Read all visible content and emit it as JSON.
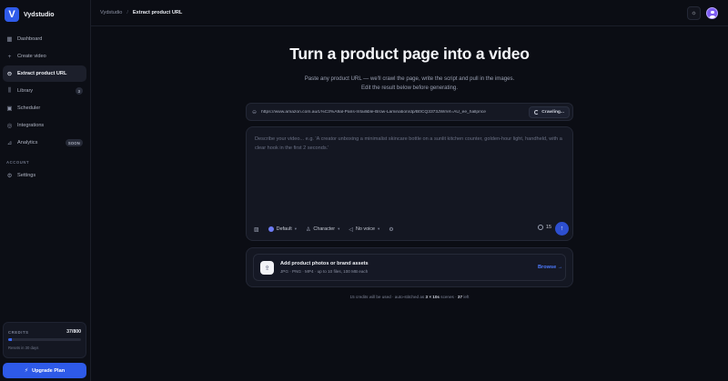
{
  "app": {
    "logo_letter": "V",
    "name": "Vydstudio"
  },
  "sidebar": {
    "items": [
      {
        "label": "Dashboard",
        "icon": "dashboard-icon",
        "active": false
      },
      {
        "label": "Create video",
        "icon": "plus-icon",
        "active": false
      },
      {
        "label": "Extract product URL",
        "icon": "link-icon",
        "active": true
      },
      {
        "label": "Library",
        "icon": "library-icon",
        "badge": "3",
        "active": false
      },
      {
        "label": "Scheduler",
        "icon": "calendar-icon",
        "active": false
      },
      {
        "label": "Integrations",
        "icon": "integrations-icon",
        "active": false
      },
      {
        "label": "Analytics",
        "icon": "chart-icon",
        "badge": "SOON",
        "active": false
      }
    ],
    "section_account": "ACCOUNT",
    "settings_label": "Settings",
    "credits": {
      "label": "CREDITS",
      "value": "37/800",
      "used": 37,
      "total": 800,
      "reset": "Resets in 30 days"
    },
    "upgrade_label": "Upgrade Plan"
  },
  "header": {
    "breadcrumb_root": "Vydstudio",
    "breadcrumb_sep": "/",
    "breadcrumb_current": "Extract product URL"
  },
  "main": {
    "title": "Turn a product page into a video",
    "subtitle_line1": "Paste any product URL — we'll crawl the page, write the script and pull in the images.",
    "subtitle_line2": "Edit the result below before generating.",
    "url_value": "https://www.amazon.com.au/L%C3%A9al-Paris-Infaillible-Brow-Lamination/dp/B0CQ3373JW/ref=AU_ee_hallprice",
    "crawl_label": "Crawling...",
    "composer_placeholder": "Describe your video... e.g. 'A creator unboxing a minimalist skincare bottle on a sunlit kitchen counter, golden-hour light, handheld, with a clear hook in the first 2 seconds.'",
    "tools": {
      "model": "Default",
      "character": "Character",
      "voice": "No voice"
    },
    "credit_cost": "15",
    "assets_title": "Add product photos or brand assets",
    "assets_sub": "JPG · PNG · MP4 · up to 10 files, 100 MB each",
    "browse_label": "Browse →",
    "footnote_pre": "15 credits will be used · auto-stitched as",
    "footnote_scenes": "3 × 10s",
    "footnote_mid": "scenes ·",
    "footnote_left": "37",
    "footnote_post": "left"
  },
  "colors": {
    "accent": "#2e5ae8",
    "background": "#0b0d14",
    "panel": "#141722",
    "link": "#4e7bff"
  }
}
